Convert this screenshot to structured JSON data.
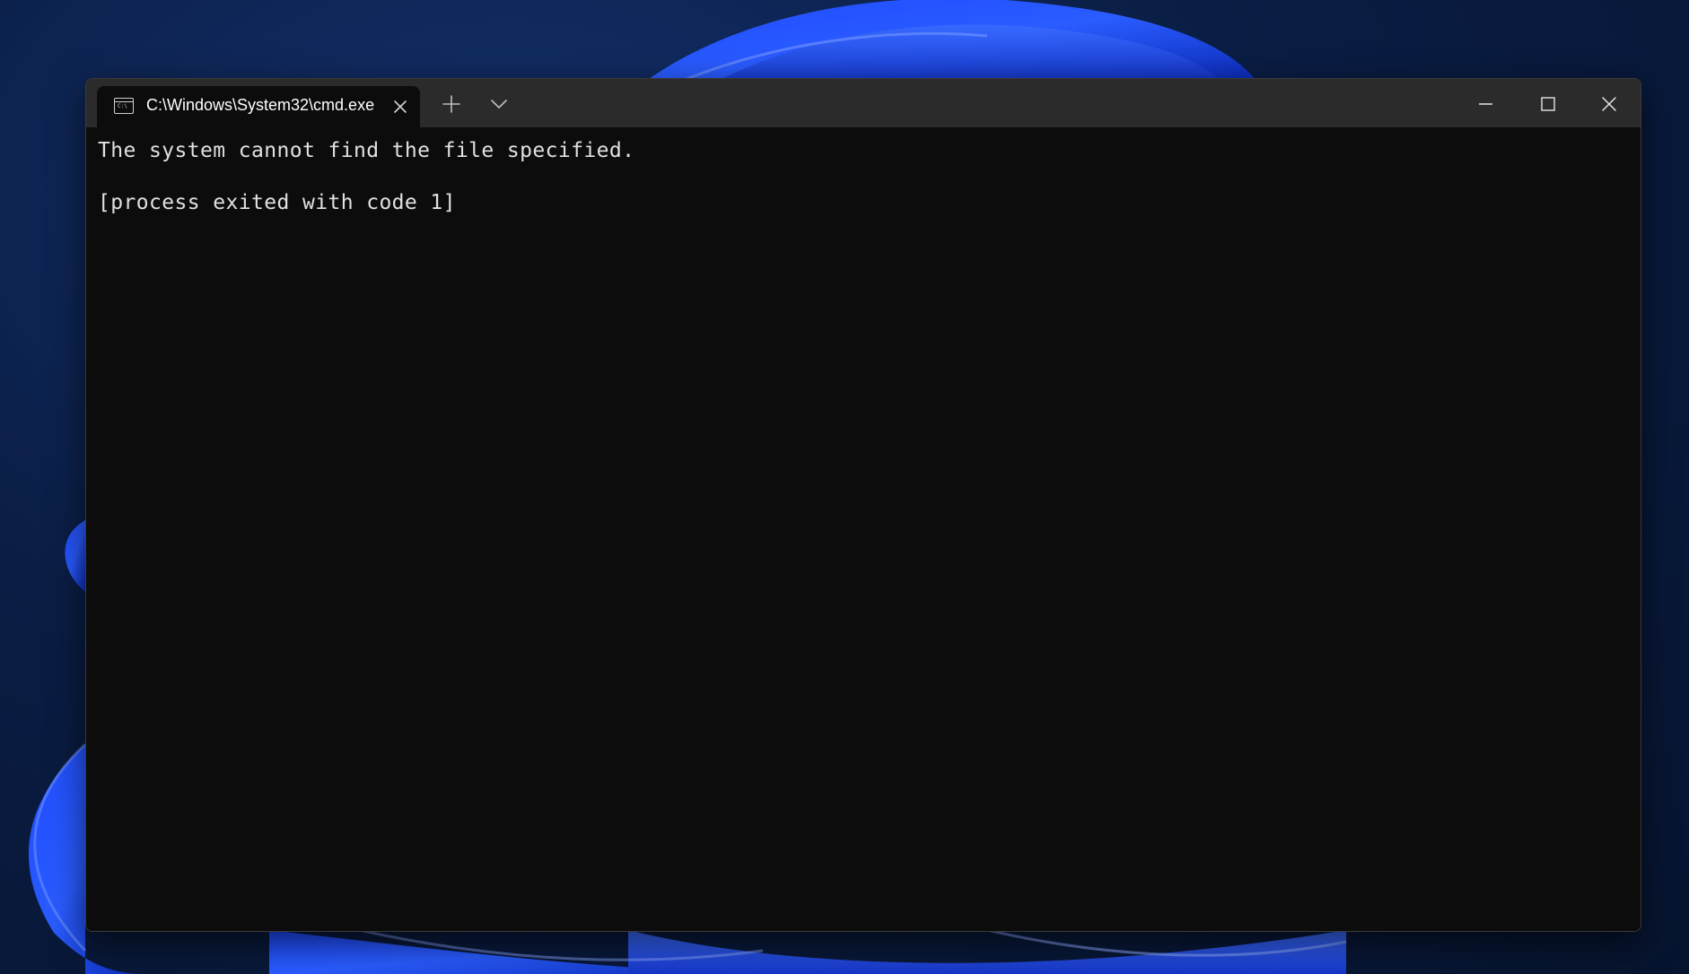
{
  "window": {
    "tab_title": "C:\\Windows\\System32\\cmd.exe",
    "tab_icon_text": "C:\\"
  },
  "icons": {
    "tab_icon": "terminal-icon",
    "tab_close": "close-icon",
    "new_tab": "plus-icon",
    "dropdown": "chevron-down-icon",
    "minimize": "minimize-icon",
    "maximize": "maximize-icon",
    "close": "close-icon"
  },
  "terminal": {
    "lines": [
      "The system cannot find the file specified.",
      "[process exited with code 1]"
    ]
  },
  "colors": {
    "titlebar_bg": "#2b2b2b",
    "terminal_bg": "#0c0c0c",
    "terminal_fg": "#e0e0e0",
    "wallpaper_accent": "#2f5bff"
  }
}
